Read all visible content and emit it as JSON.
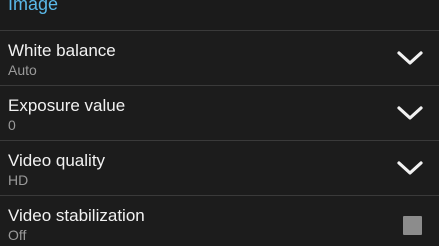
{
  "section": {
    "title": "Image"
  },
  "settings": [
    {
      "title": "White balance",
      "value": "Auto",
      "control": "chevron-down-icon"
    },
    {
      "title": "Exposure value",
      "value": "0",
      "control": "chevron-down-icon"
    },
    {
      "title": "Video quality",
      "value": "HD",
      "control": "chevron-down-icon"
    },
    {
      "title": "Video stabilization",
      "value": "Off",
      "control": "checkbox",
      "checked": false
    }
  ],
  "colors": {
    "background": "#1b1b1b",
    "accent": "#5ab8e8",
    "title_text": "#f2f2f2",
    "value_text": "#9a9a9a",
    "divider": "#3a3a3a",
    "checkbox_unchecked": "#8c8c8c"
  }
}
